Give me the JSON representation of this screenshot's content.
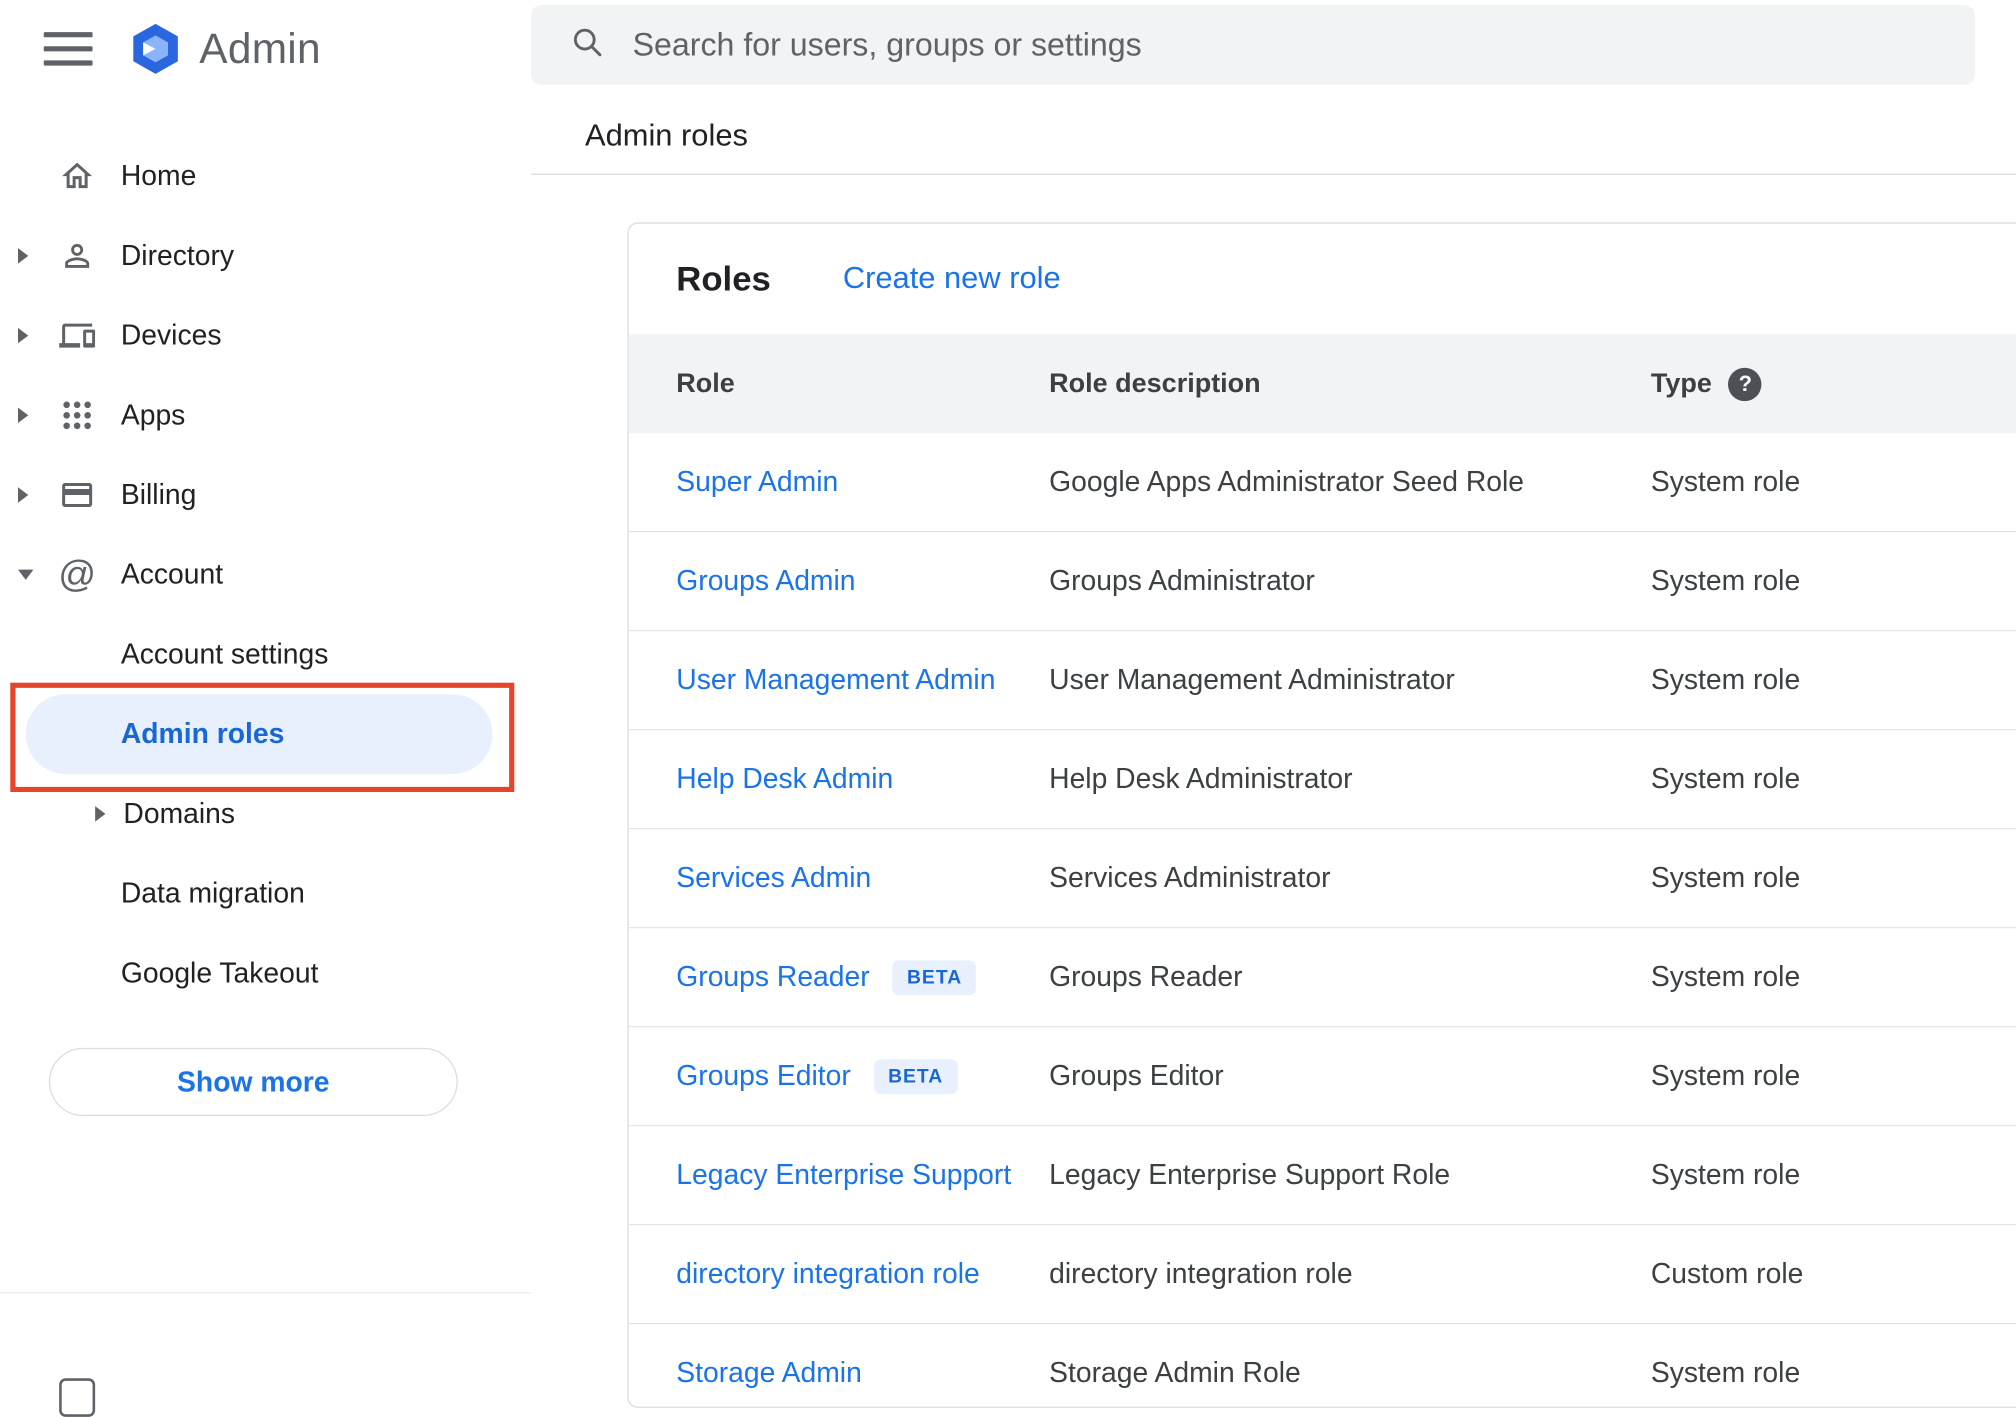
{
  "app": {
    "title": "Admin"
  },
  "search": {
    "placeholder": "Search for users, groups or settings",
    "icon": "search-icon"
  },
  "breadcrumb": {
    "label": "Admin roles"
  },
  "sidebar": {
    "menu_icon": "hamburger-menu-icon",
    "logo_icon": "admin-hexagon-logo",
    "items": [
      {
        "label": "Home",
        "icon": "home-icon",
        "expandable": false
      },
      {
        "label": "Directory",
        "icon": "person-icon",
        "expandable": true
      },
      {
        "label": "Devices",
        "icon": "devices-icon",
        "expandable": true
      },
      {
        "label": "Apps",
        "icon": "apps-grid-icon",
        "expandable": true
      },
      {
        "label": "Billing",
        "icon": "credit-card-icon",
        "expandable": true
      },
      {
        "label": "Account",
        "icon": "at-sign-icon",
        "expanded": true
      }
    ],
    "account_children": [
      {
        "label": "Account settings"
      },
      {
        "label": "Admin roles",
        "active": true
      },
      {
        "label": "Domains",
        "expandable": true
      },
      {
        "label": "Data migration"
      },
      {
        "label": "Google Takeout"
      }
    ],
    "show_more": "Show more"
  },
  "roles": {
    "title": "Roles",
    "create_new": "Create new role",
    "columns": {
      "role": "Role",
      "description": "Role description",
      "type": "Type"
    },
    "type_help_icon": "help-icon",
    "help_glyph": "?",
    "rows": [
      {
        "role": "Super Admin",
        "description": "Google Apps Administrator Seed Role",
        "type": "System role"
      },
      {
        "role": "Groups Admin",
        "description": "Groups Administrator",
        "type": "System role"
      },
      {
        "role": "User Management Admin",
        "description": "User Management Administrator",
        "type": "System role"
      },
      {
        "role": "Help Desk Admin",
        "description": "Help Desk Administrator",
        "type": "System role"
      },
      {
        "role": "Services Admin",
        "description": "Services Administrator",
        "type": "System role"
      },
      {
        "role": "Groups Reader",
        "beta": "BETA",
        "description": "Groups Reader",
        "type": "System role"
      },
      {
        "role": "Groups Editor",
        "beta": "BETA",
        "description": "Groups Editor",
        "type": "System role"
      },
      {
        "role": "Legacy Enterprise Support",
        "description": "Legacy Enterprise Support Role",
        "type": "System role"
      },
      {
        "role": "directory integration role",
        "description": "directory integration role",
        "type": "Custom role"
      },
      {
        "role": "Storage Admin",
        "description": "Storage Admin Role",
        "type": "System role"
      }
    ]
  },
  "colors": {
    "link_blue": "#1a73e8",
    "active_item_bg": "#e8f0fe",
    "active_item_text": "#1967d2",
    "search_bar_bg": "#f1f3f4",
    "table_header_bg": "#f1f3f4",
    "annotation_red": "#e8442c",
    "beta_badge_bg": "#e8f0fe",
    "beta_badge_text": "#1967d2",
    "icon_gray": "#5f6368"
  }
}
